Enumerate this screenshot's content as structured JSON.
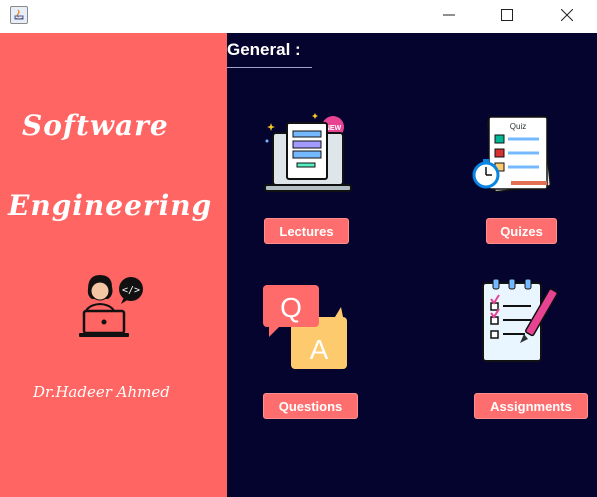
{
  "window": {
    "buttons": {
      "minimize": "minimize",
      "maximize": "maximize",
      "close": "close"
    }
  },
  "sidebar": {
    "title_line1": "Software",
    "title_line2": "Engineering",
    "author": "Dr.Hadeer Ahmed"
  },
  "main": {
    "section_title": "General :",
    "tiles": [
      {
        "label": "Lectures",
        "icon": "laptop-new-icon"
      },
      {
        "label": "Quizes",
        "icon": "quiz-stopwatch-icon"
      },
      {
        "label": "Questions",
        "icon": "qa-bubbles-icon"
      },
      {
        "label": "Assignments",
        "icon": "clipboard-pencil-icon"
      }
    ],
    "icon_texts": {
      "new_badge": "NEW",
      "quiz": "Quiz",
      "q": "Q",
      "a": "A"
    }
  },
  "colors": {
    "sidebar_bg": "#ff6562",
    "main_bg": "#05042f",
    "button_bg": "#ff6e6e",
    "text": "#ffffff"
  }
}
